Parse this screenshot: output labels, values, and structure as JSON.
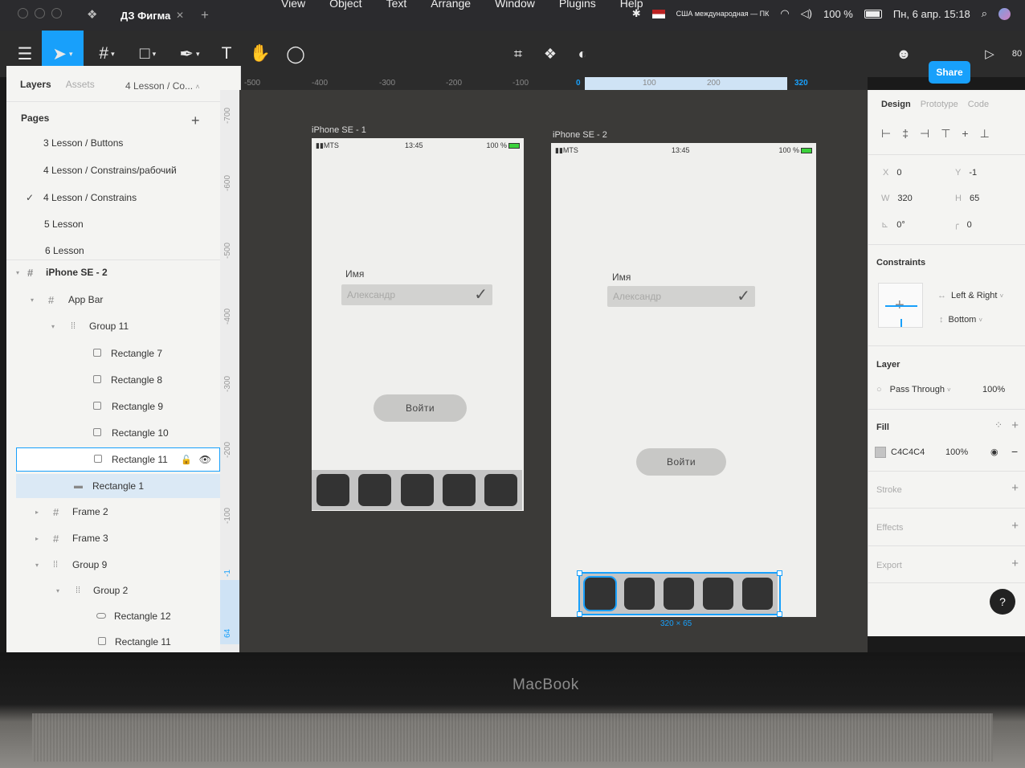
{
  "menubar": {
    "file_tab": "ДЗ Фигма",
    "menus": [
      "View",
      "Object",
      "Text",
      "Arrange",
      "Window",
      "Plugins",
      "Help"
    ],
    "keyboard_layout": "США международная — ПК",
    "battery": "100 %",
    "datetime": "Пн, 6 апр. 15:18"
  },
  "toolbar": {
    "tools": [
      "move-icon",
      "frame-icon",
      "rectangle-icon",
      "pen-icon",
      "text-icon",
      "hand-icon",
      "comment-icon"
    ],
    "text_tool_glyph": "T",
    "share_label": "Share",
    "zoom": "80"
  },
  "left_panel": {
    "tabs": [
      "Layers",
      "Assets"
    ],
    "current_page": "4 Lesson / Co...",
    "pages_title": "Pages",
    "pages": [
      {
        "label": "3 Lesson / Buttons",
        "checked": false
      },
      {
        "label": "4 Lesson / Constrains/рабочий",
        "checked": false
      },
      {
        "label": "4 Lesson / Constrains",
        "checked": true
      },
      {
        "label": "5 Lesson",
        "checked": false
      },
      {
        "label": "6 Lesson",
        "checked": false
      }
    ],
    "layers": [
      {
        "label": "iPhone SE - 2",
        "type": "frame"
      },
      {
        "label": "App Bar",
        "type": "frame"
      },
      {
        "label": "Group 11",
        "type": "group"
      },
      {
        "label": "Rectangle 7",
        "type": "rect"
      },
      {
        "label": "Rectangle 8",
        "type": "rect"
      },
      {
        "label": "Rectangle 9",
        "type": "rect"
      },
      {
        "label": "Rectangle 10",
        "type": "rect"
      },
      {
        "label": "Rectangle 11",
        "type": "rect"
      },
      {
        "label": "Rectangle 1",
        "type": "line"
      },
      {
        "label": "Frame 2",
        "type": "frame"
      },
      {
        "label": "Frame 3",
        "type": "frame"
      },
      {
        "label": "Group 9",
        "type": "group"
      },
      {
        "label": "Group 2",
        "type": "group"
      },
      {
        "label": "Rectangle 12",
        "type": "rect"
      },
      {
        "label": "Rectangle 11",
        "type": "rect"
      }
    ]
  },
  "rulers": {
    "top": [
      "-500",
      "-400",
      "-300",
      "-200",
      "-100",
      "0",
      "100",
      "200",
      "320"
    ],
    "left": [
      "-700",
      "-600",
      "-500",
      "-400",
      "-300",
      "-200",
      "-100",
      "-1",
      "64"
    ]
  },
  "canvas": {
    "frame1": {
      "label": "iPhone SE - 1",
      "carrier": "MTS",
      "time": "13:45",
      "battery": "100 %",
      "field_label": "Имя",
      "field_placeholder": "Александр",
      "button": "Войти"
    },
    "frame2": {
      "label": "iPhone SE - 2",
      "carrier": "MTS",
      "time": "13:45",
      "battery": "100 %",
      "field_label": "Имя",
      "field_placeholder": "Александр",
      "button": "Войти",
      "selection_size": "320 × 65"
    }
  },
  "right_panel": {
    "tabs": [
      "Design",
      "Prototype",
      "Code"
    ],
    "x": "0",
    "y": "-1",
    "w": "320",
    "h": "65",
    "rotation": "0°",
    "radius": "0",
    "constraints_title": "Constraints",
    "horizontal": "Left & Right",
    "vertical": "Bottom",
    "layer_title": "Layer",
    "blend": "Pass Through",
    "opacity": "100%",
    "fill_title": "Fill",
    "fill_hex": "C4C4C4",
    "fill_opacity": "100%",
    "stroke_title": "Stroke",
    "effects_title": "Effects",
    "export_title": "Export"
  },
  "bezel": {
    "brand": "MacBook"
  }
}
